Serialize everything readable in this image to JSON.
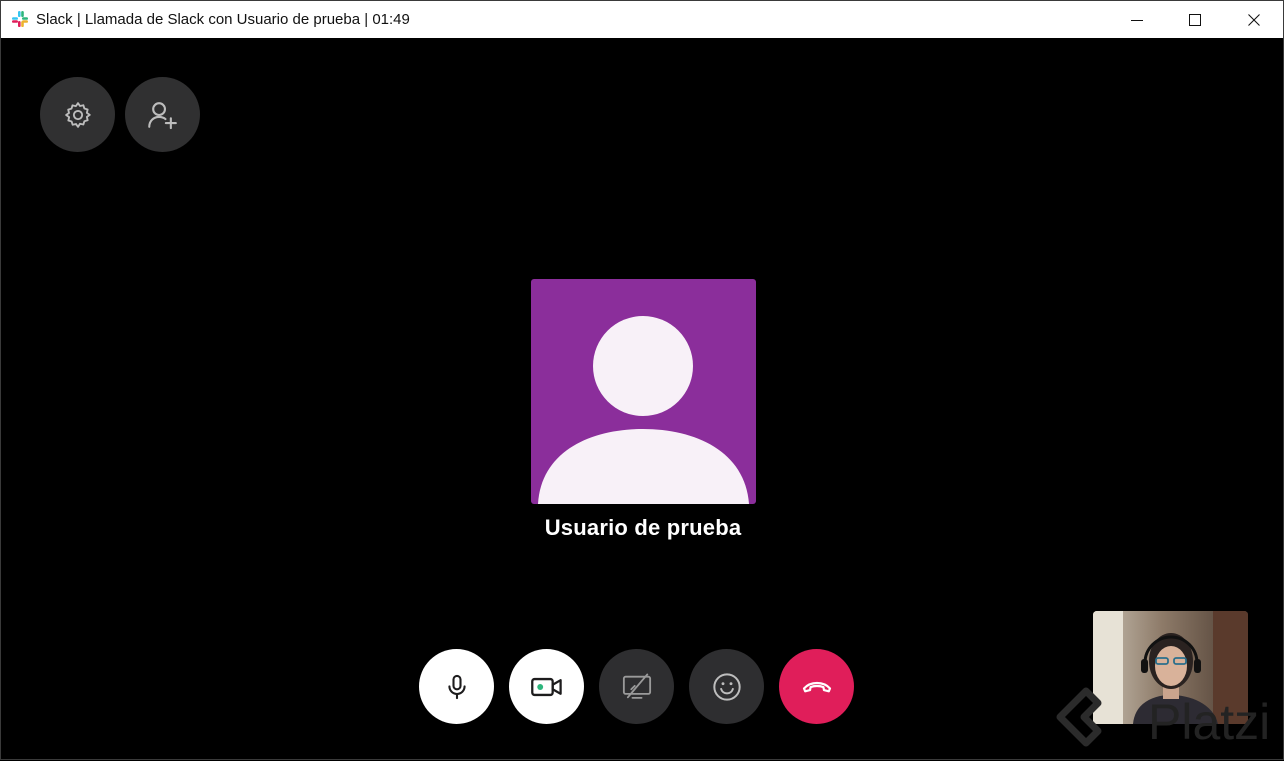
{
  "window": {
    "title": "Slack | Llamada de Slack con Usuario de prueba | 01:49",
    "app_icon": "slack-icon",
    "controls": [
      "minimize-icon",
      "maximize-icon",
      "close-icon"
    ]
  },
  "top_actions": [
    {
      "name": "settings-button",
      "icon": "gear-icon"
    },
    {
      "name": "add-participant-button",
      "icon": "add-user-icon"
    }
  ],
  "call": {
    "participant_name": "Usuario de prueba",
    "avatar_color": "#8b2e9b"
  },
  "controls": [
    {
      "name": "microphone-button",
      "icon": "microphone-icon",
      "state": "on"
    },
    {
      "name": "video-button",
      "icon": "video-camera-icon",
      "state": "on"
    },
    {
      "name": "screen-share-button",
      "icon": "screen-share-off-icon",
      "state": "off"
    },
    {
      "name": "reaction-button",
      "icon": "emoji-icon"
    },
    {
      "name": "hang-up-button",
      "icon": "hang-up-icon",
      "color": "#e01e5a"
    }
  ],
  "self_view": {
    "icon": "self-camera-preview"
  },
  "watermark": {
    "text": "Platzi"
  }
}
